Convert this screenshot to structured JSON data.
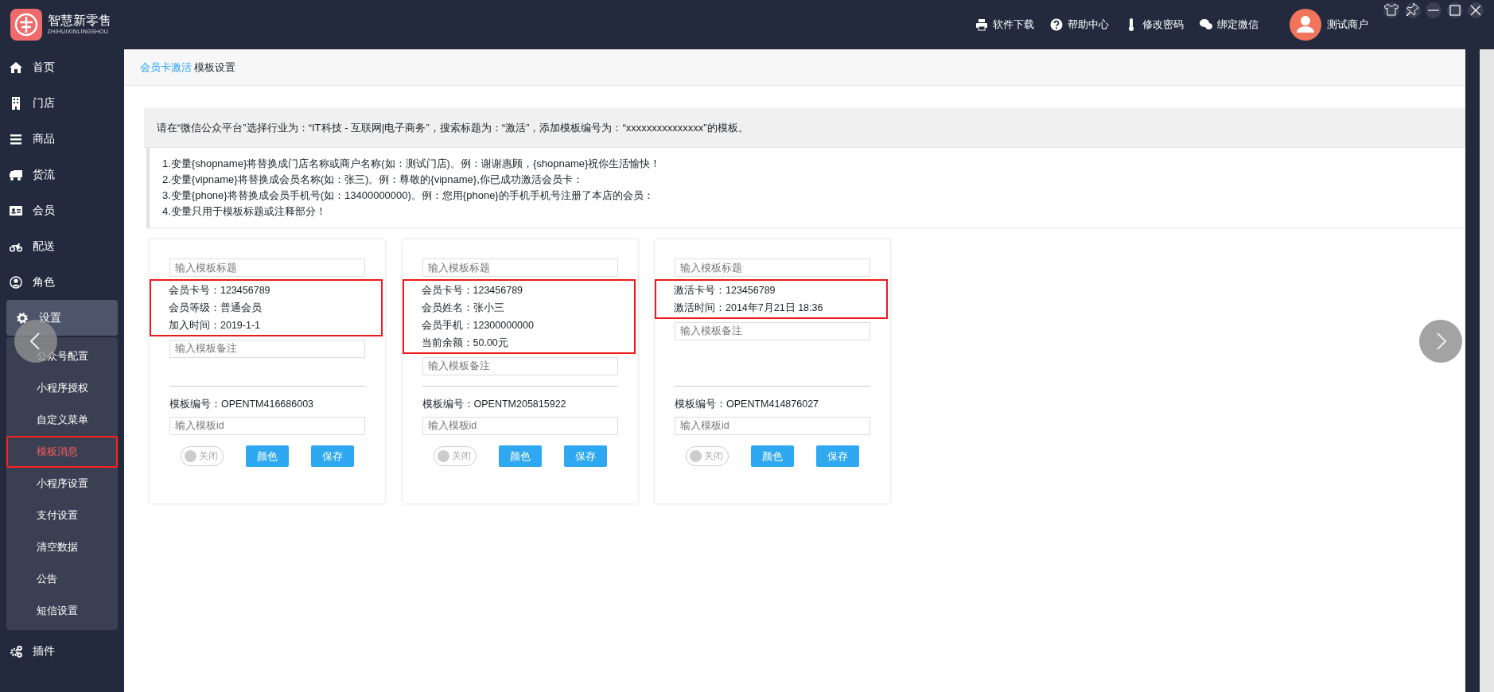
{
  "app": {
    "name": "智慧新零售",
    "subtitle": "ZHIHUIXINLINGSHOU"
  },
  "top_links": [
    {
      "kind": "download",
      "label": "软件下载"
    },
    {
      "kind": "help",
      "label": "帮助中心"
    },
    {
      "kind": "password",
      "label": "修改密码"
    },
    {
      "kind": "wechat",
      "label": "绑定微信"
    }
  ],
  "user": {
    "name": "测试商户"
  },
  "sidebar": {
    "items": [
      {
        "kind": "home",
        "label": "首页",
        "expanded": false
      },
      {
        "kind": "store",
        "label": "门店",
        "expanded": false
      },
      {
        "kind": "goods",
        "label": "商品",
        "expanded": false
      },
      {
        "kind": "logistics",
        "label": "货流",
        "expanded": false
      },
      {
        "kind": "member",
        "label": "会员",
        "expanded": false
      },
      {
        "kind": "delivery",
        "label": "配送",
        "expanded": false
      },
      {
        "kind": "role",
        "label": "角色",
        "expanded": false
      },
      {
        "kind": "settings",
        "label": "设置",
        "expanded": true,
        "children": [
          {
            "label": "公众号配置",
            "selected": false
          },
          {
            "label": "小程序授权",
            "selected": false
          },
          {
            "label": "自定义菜单",
            "selected": false
          },
          {
            "label": "模板消息",
            "selected": true
          },
          {
            "label": "小程序设置",
            "selected": false
          },
          {
            "label": "支付设置",
            "selected": false
          },
          {
            "label": "清空数据",
            "selected": false
          },
          {
            "label": "公告",
            "selected": false
          },
          {
            "label": "短信设置",
            "selected": false
          }
        ]
      },
      {
        "kind": "plugins",
        "label": "插件",
        "expanded": false
      }
    ]
  },
  "breadcrumb": [
    {
      "label": "会员卡激活",
      "kind": "link"
    },
    {
      "label": "模板设置",
      "kind": "current"
    }
  ],
  "notice": "请在“微信公众平台”选择行业为：“IT科技 - 互联网|电子商务”，搜索标题为：“激活”，添加模板编号为：“xxxxxxxxxxxxxxx”的模板。",
  "rules": [
    "1.变量{shopname}将替换成门店名称或商户名称(如：测试门店)。例：谢谢惠顾，{shopname}祝你生活愉快！",
    "2.变量{vipname}将替换成会员名称(如：张三)。例：尊敬的{vipname},你已成功激活会员卡：",
    "3.变量{phone}将替换成会员手机号(如：13400000000)。例：您用{phone}的手机手机号注册了本店的会员：",
    "4.变量只用于模板标题或注释部分！"
  ],
  "cards": [
    {
      "title_placeholder": "输入模板标题",
      "lines": [
        "会员卡号：123456789",
        "会员等级：普通会员",
        "加入时间：2019-1-1"
      ],
      "note_placeholder": "输入模板备注",
      "template_code": "模板编号：OPENTM416686003",
      "id_placeholder": "输入模板id",
      "toggle": {
        "label": "关闭",
        "on": false
      },
      "color_button": "颜色",
      "save_button": "保存"
    },
    {
      "title_placeholder": "输入模板标题",
      "lines": [
        "会员卡号：123456789",
        "会员姓名：张小三",
        "会员手机：12300000000",
        "当前余额：50.00元"
      ],
      "note_placeholder": "输入模板备注",
      "template_code": "模板编号：OPENTM205815922",
      "id_placeholder": "输入模板id",
      "toggle": {
        "label": "关闭",
        "on": false
      },
      "color_button": "颜色",
      "save_button": "保存"
    },
    {
      "title_placeholder": "输入模板标题",
      "lines": [
        "激活卡号：123456789",
        "激活时间：2014年7月21日 18:36"
      ],
      "note_placeholder": "输入模板备注",
      "template_code": "模板编号：OPENTM414876027",
      "id_placeholder": "输入模板id",
      "toggle": {
        "label": "关闭",
        "on": false
      },
      "color_button": "颜色",
      "save_button": "保存"
    }
  ]
}
